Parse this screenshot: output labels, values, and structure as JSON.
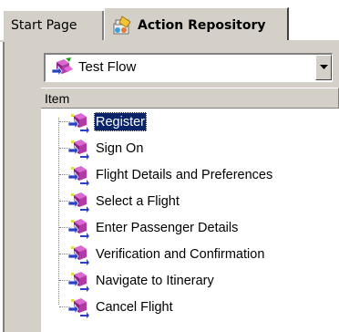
{
  "tabs": {
    "start_page": "Start Page",
    "action_repository": "Action Repository"
  },
  "flow_selector": {
    "selected": "Test Flow"
  },
  "list": {
    "column_header": "Item",
    "items": [
      {
        "label": "Register",
        "selected": true
      },
      {
        "label": "Sign On",
        "selected": false
      },
      {
        "label": "Flight Details and Preferences",
        "selected": false
      },
      {
        "label": "Select a Flight",
        "selected": false
      },
      {
        "label": "Enter Passenger Details",
        "selected": false
      },
      {
        "label": "Verification and Confirmation",
        "selected": false
      },
      {
        "label": "Navigate to Itinerary",
        "selected": false
      },
      {
        "label": "Cancel Flight",
        "selected": false
      }
    ]
  },
  "colors": {
    "selection": "#0a246a",
    "chrome": "#d4d0c8",
    "action_icon": "#9c2a8c"
  },
  "icons": {
    "tab": "repository-icon",
    "flow": "flow-icon",
    "action": "action-icon",
    "dropdown": "chevron-down-icon"
  }
}
